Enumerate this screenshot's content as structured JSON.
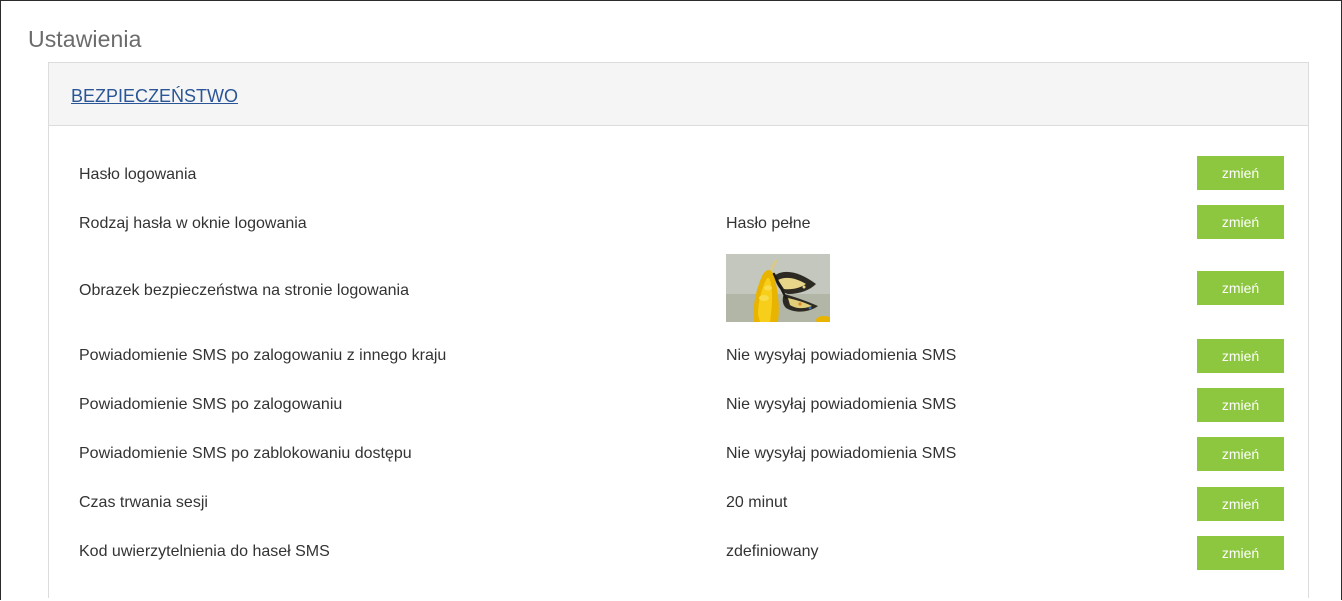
{
  "page": {
    "title": "Ustawienia"
  },
  "section": {
    "title": "BEZPIECZEŃSTWO"
  },
  "rows": [
    {
      "label": "Hasło logowania",
      "value": "",
      "button": "zmień"
    },
    {
      "label": "Rodzaj hasła w oknie logowania",
      "value": "Hasło pełne",
      "button": "zmień"
    },
    {
      "label": "Obrazek bezpieczeństwa na stronie logowania",
      "value": "",
      "button": "zmień",
      "image": "butterfly-on-flower"
    },
    {
      "label": "Powiadomienie SMS po zalogowaniu z innego kraju",
      "value": "Nie wysyłaj powiadomienia SMS",
      "button": "zmień"
    },
    {
      "label": "Powiadomienie SMS po zalogowaniu",
      "value": "Nie wysyłaj powiadomienia SMS",
      "button": "zmień"
    },
    {
      "label": "Powiadomienie SMS po zablokowaniu dostępu",
      "value": "Nie wysyłaj powiadomienia SMS",
      "button": "zmień"
    },
    {
      "label": "Czas trwania sesji",
      "value": "20 minut",
      "button": "zmień"
    },
    {
      "label": "Kod uwierzytelnienia do haseł SMS",
      "value": "zdefiniowany",
      "button": "zmień"
    }
  ],
  "colors": {
    "button": "#8dc63f",
    "link": "#2a5596",
    "header_bg": "#f5f5f5"
  }
}
